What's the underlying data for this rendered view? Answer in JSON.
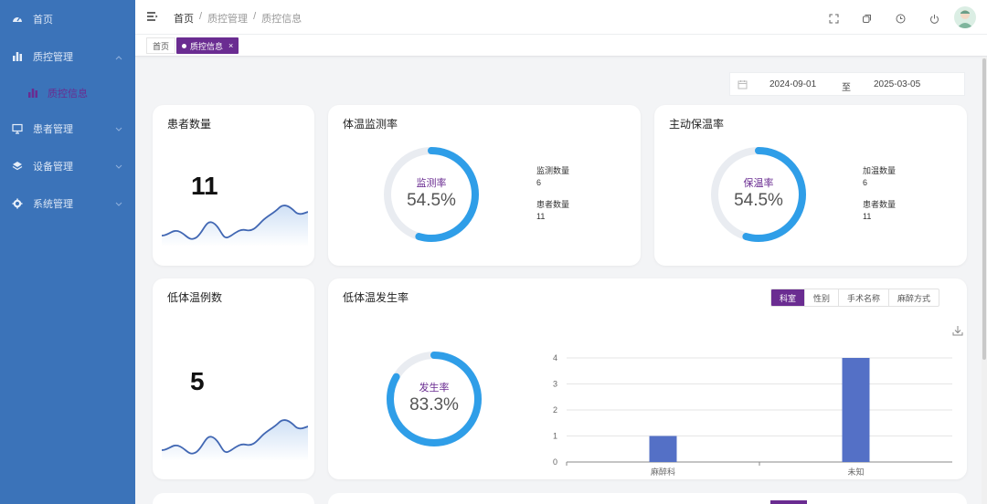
{
  "sidebar": {
    "items": [
      {
        "label": "首页",
        "icon": "dashboard-icon"
      },
      {
        "label": "质控管理",
        "icon": "bar-chart-icon"
      },
      {
        "label": "质控信息",
        "icon": "bar-chart-icon"
      },
      {
        "label": "患者管理",
        "icon": "monitor-icon"
      },
      {
        "label": "设备管理",
        "icon": "layers-icon"
      },
      {
        "label": "系统管理",
        "icon": "gear-icon"
      }
    ]
  },
  "header": {
    "breadcrumb": [
      "首页",
      "质控管理",
      "质控信息"
    ],
    "breadcrumb_sep": "/"
  },
  "tabs": {
    "home": "首页",
    "active": "质控信息",
    "close": "×"
  },
  "daterange": {
    "start": "2024-09-01",
    "sep": "至",
    "end": "2025-03-05"
  },
  "cards": {
    "patients": {
      "title": "患者数量",
      "value": "11"
    },
    "temp_monitor": {
      "title": "体温监测率",
      "ring_label": "监测率",
      "percent": "54.5%",
      "ratio": 0.545,
      "stat1_label": "监测数量",
      "stat1_value": "6",
      "stat2_label": "患者数量",
      "stat2_value": "11"
    },
    "active_warming": {
      "title": "主动保温率",
      "ring_label": "保温率",
      "percent": "54.5%",
      "ratio": 0.545,
      "stat1_label": "加温数量",
      "stat1_value": "6",
      "stat2_label": "患者数量",
      "stat2_value": "11"
    },
    "hypothermia_cases": {
      "title": "低体温例数",
      "value": "5"
    },
    "hypothermia_rate": {
      "title": "低体温发生率",
      "ring_label": "发生率",
      "percent": "83.3%",
      "ratio": 0.833,
      "segments": [
        "科室",
        "性别",
        "手术名称",
        "麻醉方式"
      ]
    }
  },
  "colors": {
    "sidebar": "#3b73b9",
    "accent": "#6a2c91",
    "ring": "#2f9ee8",
    "ring_track": "#e9ecf1",
    "bar": "#5470c6"
  },
  "chart_data": {
    "type": "bar",
    "categories": [
      "麻醉科",
      "未知"
    ],
    "values": [
      1,
      4
    ],
    "ylim": [
      0,
      4
    ],
    "yticks": [
      "0",
      "1",
      "2",
      "3",
      "4"
    ],
    "grid": true
  }
}
